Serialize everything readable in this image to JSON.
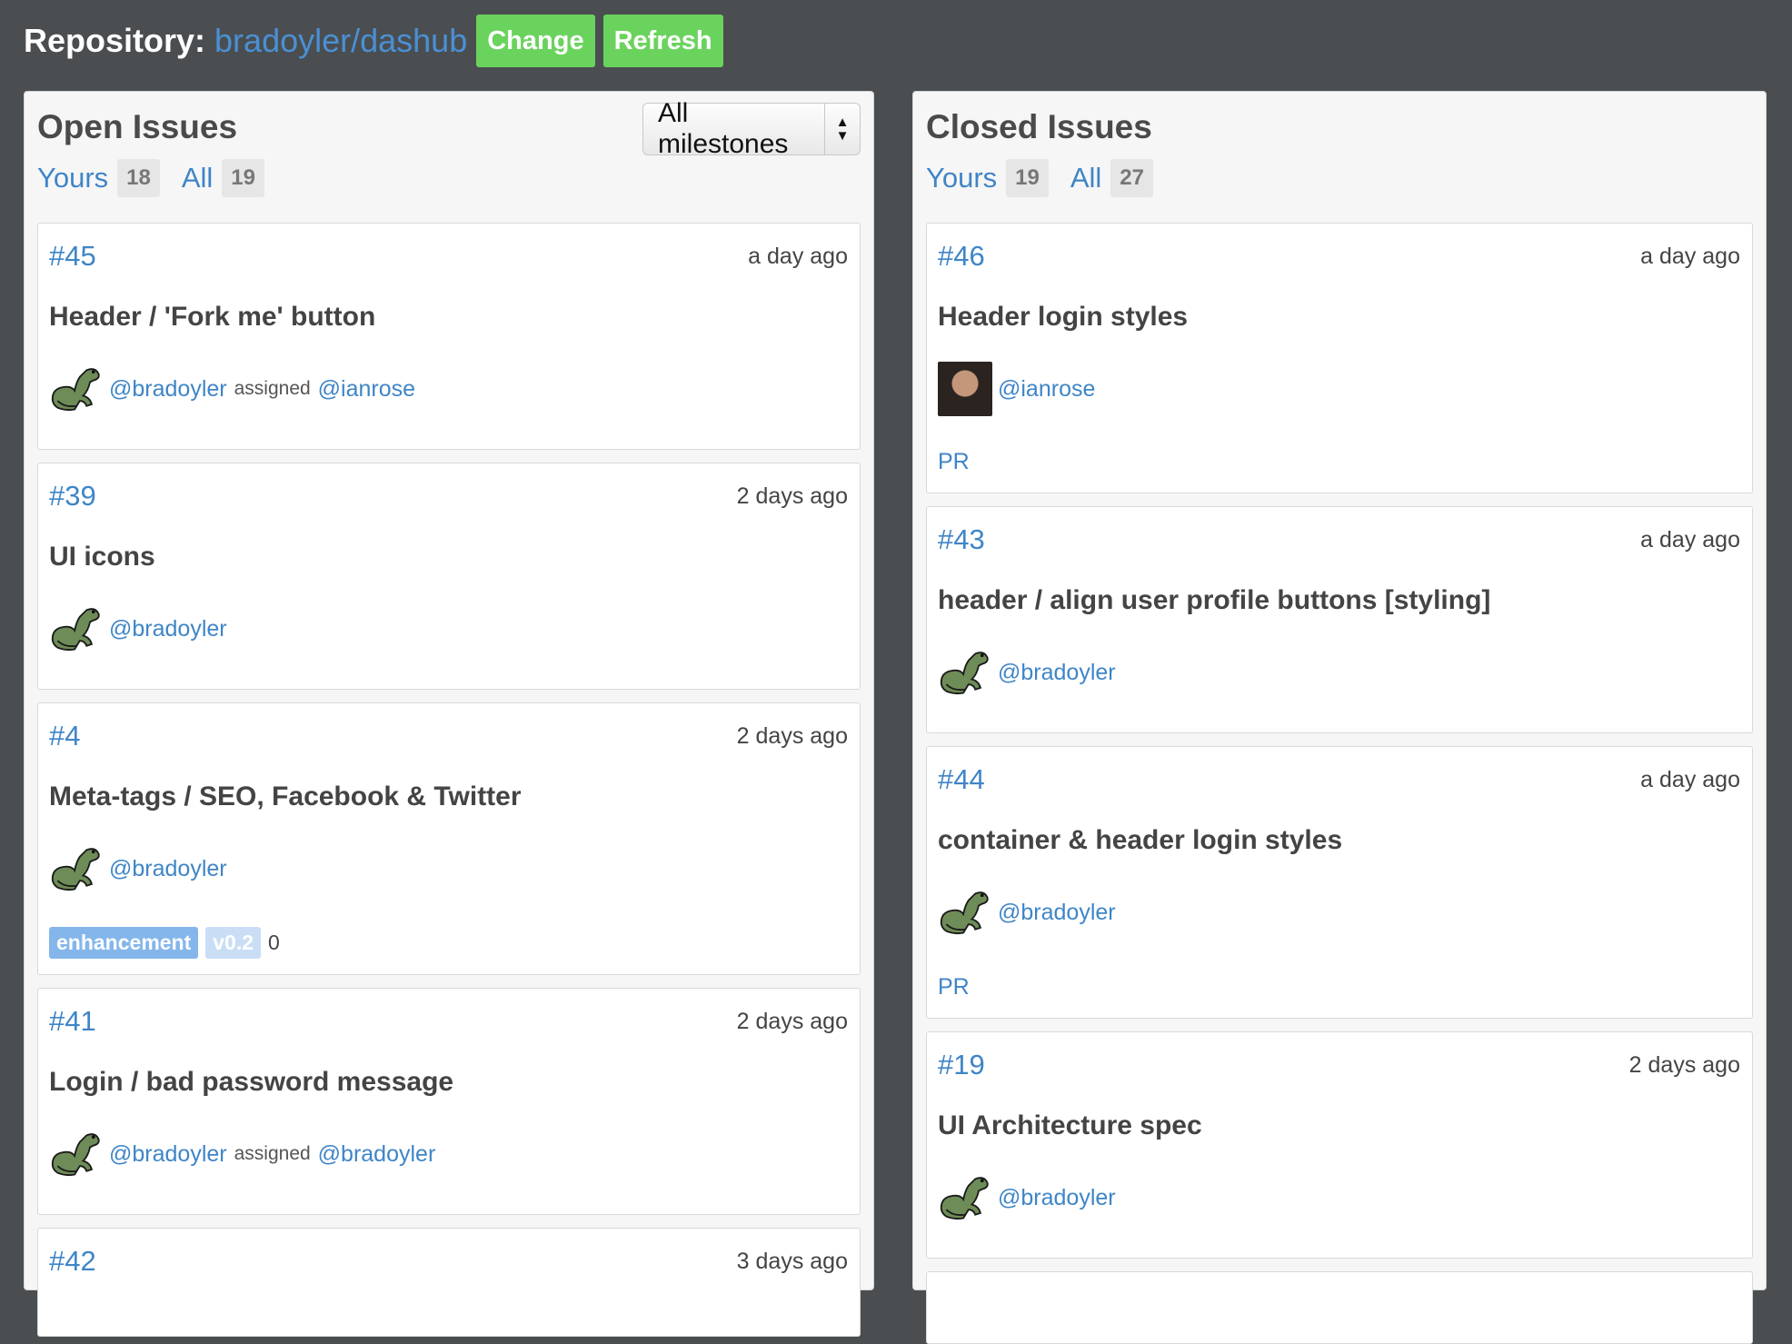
{
  "header": {
    "label": "Repository:",
    "repo": "bradoyler/dashub",
    "change_label": "Change",
    "refresh_label": "Refresh"
  },
  "colors": {
    "accent": "#3f85c7",
    "button_green": "#6ad35d",
    "background": "#4a4e50"
  },
  "open": {
    "title": "Open Issues",
    "milestone_select": "All milestones",
    "filters": [
      {
        "label": "Yours",
        "count": "18"
      },
      {
        "label": "All",
        "count": "19"
      }
    ],
    "issues": [
      {
        "number": "#45",
        "time": "a day ago",
        "title": "Header / 'Fork me' button",
        "author": "@bradoyler",
        "assigned_text": "assigned",
        "assignee": "@ianrose"
      },
      {
        "number": "#39",
        "time": "2 days ago",
        "title": "UI icons",
        "author": "@bradoyler"
      },
      {
        "number": "#4",
        "time": "2 days ago",
        "title": "Meta-tags / SEO, Facebook & Twitter",
        "author": "@bradoyler",
        "labels": [
          "enhancement",
          "v0.2"
        ],
        "comments": "0"
      },
      {
        "number": "#41",
        "time": "2 days ago",
        "title": "Login / bad password message",
        "author": "@bradoyler",
        "assigned_text": "assigned",
        "assignee": "@bradoyler"
      },
      {
        "number": "#42",
        "time": "3 days ago"
      }
    ]
  },
  "closed": {
    "title": "Closed Issues",
    "filters": [
      {
        "label": "Yours",
        "count": "19"
      },
      {
        "label": "All",
        "count": "27"
      }
    ],
    "issues": [
      {
        "number": "#46",
        "time": "a day ago",
        "title": "Header login styles",
        "author": "@ianrose",
        "pr": "PR"
      },
      {
        "number": "#43",
        "time": "a day ago",
        "title": "header / align user profile buttons [styling]",
        "author": "@bradoyler"
      },
      {
        "number": "#44",
        "time": "a day ago",
        "title": "container & header login styles",
        "author": "@bradoyler",
        "pr": "PR"
      },
      {
        "number": "#19",
        "time": "2 days ago",
        "title": "UI Architecture spec",
        "author": "@bradoyler"
      }
    ]
  }
}
